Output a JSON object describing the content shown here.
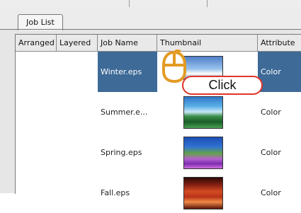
{
  "tab": {
    "label": "Job List"
  },
  "columns": [
    {
      "label": "Arranged"
    },
    {
      "label": "Layered"
    },
    {
      "label": "Job Name"
    },
    {
      "label": "Thumbnail"
    },
    {
      "label": "Attribute"
    }
  ],
  "rows": [
    {
      "name": "Winter.eps",
      "attribute": "Color",
      "selected": true
    },
    {
      "name": "Summer.e...",
      "attribute": "Color",
      "selected": false
    },
    {
      "name": "Spring.eps",
      "attribute": "Color",
      "selected": false
    },
    {
      "name": "Fall.eps",
      "attribute": "Color",
      "selected": false
    }
  ],
  "callout": {
    "label": "Click"
  },
  "colors": {
    "selection": "#3d6a97",
    "callout_border": "#e0352b",
    "mouse": "#e39b24"
  }
}
